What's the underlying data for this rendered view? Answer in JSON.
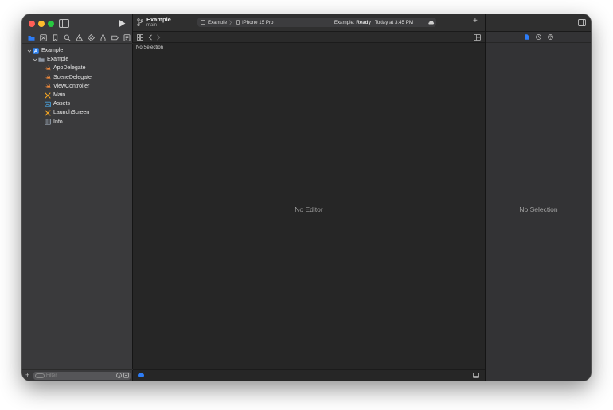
{
  "toolbar": {
    "project_title": "Example",
    "branch": "main",
    "scheme": "Example",
    "scheme_separator": "〉",
    "destination": "iPhone 15 Pro",
    "status_prefix": "Example: ",
    "status_state": "Ready",
    "status_suffix": " | Today at 3:45 PM"
  },
  "navigator": {
    "tabs": [
      "folder-icon",
      "source-control-icon",
      "bookmark-icon",
      "search-icon",
      "warning-icon",
      "test-icon",
      "debug-icon",
      "breakpoint-icon",
      "report-icon"
    ],
    "tree": [
      {
        "label": "Example",
        "level": 0,
        "icon": "project-icon",
        "expanded": true
      },
      {
        "label": "Example",
        "level": 1,
        "icon": "folder-icon",
        "expanded": true
      },
      {
        "label": "AppDelegate",
        "level": 2,
        "icon": "swift-icon"
      },
      {
        "label": "SceneDelegate",
        "level": 2,
        "icon": "swift-icon"
      },
      {
        "label": "ViewController",
        "level": 2,
        "icon": "swift-icon"
      },
      {
        "label": "Main",
        "level": 2,
        "icon": "storyboard-icon"
      },
      {
        "label": "Assets",
        "level": 2,
        "icon": "assets-icon"
      },
      {
        "label": "LaunchScreen",
        "level": 2,
        "icon": "storyboard-icon"
      },
      {
        "label": "Info",
        "level": 2,
        "icon": "plist-icon"
      }
    ],
    "filter_placeholder": "Filter"
  },
  "editor": {
    "breadcrumb": "No Selection",
    "empty_message": "No Editor"
  },
  "inspector": {
    "empty_message": "No Selection"
  },
  "colors": {
    "accent": "#2d7cf6",
    "swift": "#f28a3b",
    "storyboard": "#f5a623",
    "assets": "#4aa3df"
  }
}
